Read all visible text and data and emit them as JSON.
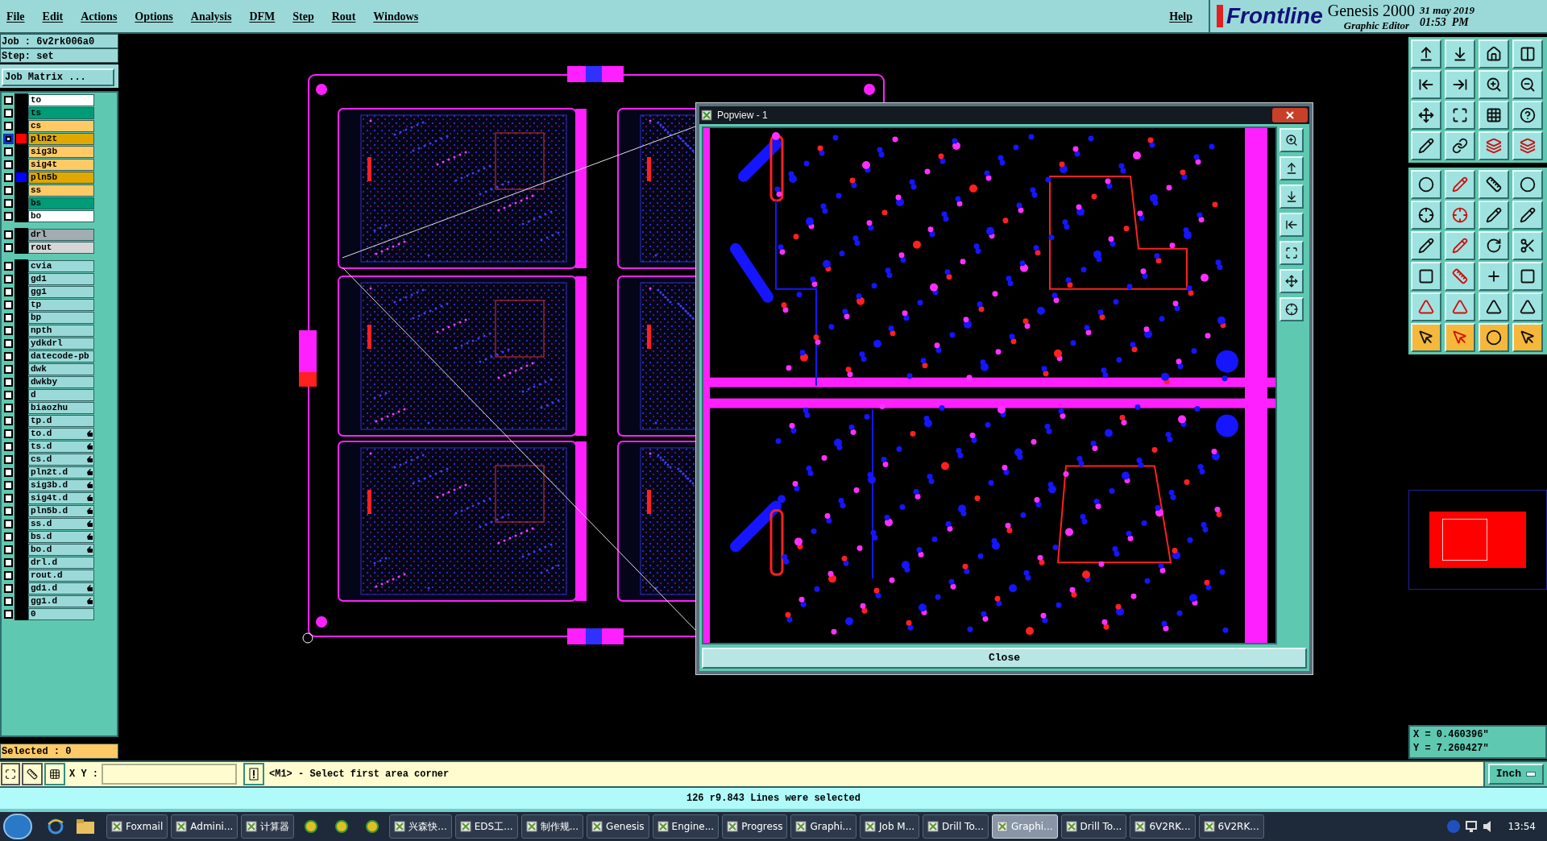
{
  "menu": [
    {
      "label": "File"
    },
    {
      "label": "Edit"
    },
    {
      "label": "Actions"
    },
    {
      "label": "Options"
    },
    {
      "label": "Analysis"
    },
    {
      "label": "DFM"
    },
    {
      "label": "Step"
    },
    {
      "label": "Rout"
    },
    {
      "label": "Windows"
    }
  ],
  "help": "Help",
  "brand": {
    "logo": "Frontline",
    "product": "Genesis 2000",
    "subtitle": "Graphic Editor",
    "date": "31 may 2019",
    "time": "01:53  PM"
  },
  "job": {
    "job": "Job : 6v2rk006a0",
    "step": "Step: set",
    "matrix_button": "Job Matrix ..."
  },
  "layer_groups": [
    [
      {
        "name": "to",
        "color": "#ffffff",
        "selected": false
      },
      {
        "name": "ts",
        "color": "#009b77",
        "selected": false
      },
      {
        "name": "cs",
        "color": "#ffc966",
        "selected": false
      },
      {
        "name": "pln2t",
        "color": "#e0a800",
        "selected": true,
        "swatch": {
          "color": "#ff0000"
        }
      },
      {
        "name": "sig3b",
        "color": "#ffc966",
        "selected": false
      },
      {
        "name": "sig4t",
        "color": "#ffc966",
        "selected": false
      },
      {
        "name": "pln5b",
        "color": "#e0a800",
        "selected": false,
        "swatch": {
          "color": "#0000ff"
        }
      },
      {
        "name": "ss",
        "color": "#ffc966",
        "selected": false
      },
      {
        "name": "bs",
        "color": "#009b77",
        "selected": false
      },
      {
        "name": "bo",
        "color": "#ffffff",
        "selected": false
      }
    ],
    [
      {
        "name": "drl",
        "color": "#a3acb2",
        "selected": false
      },
      {
        "name": "rout",
        "color": "#d6d6d6",
        "selected": false
      }
    ],
    [
      {
        "name": "cvia",
        "selected": false,
        "linked": false
      },
      {
        "name": "gd1",
        "selected": false,
        "linked": false
      },
      {
        "name": "gg1",
        "selected": false,
        "linked": false
      },
      {
        "name": "tp",
        "selected": false,
        "linked": false
      },
      {
        "name": "bp",
        "selected": false,
        "linked": false
      },
      {
        "name": "npth",
        "selected": false,
        "linked": false
      },
      {
        "name": "ydkdrl",
        "selected": false,
        "linked": false
      },
      {
        "name": "datecode-pb",
        "selected": false,
        "linked": false
      },
      {
        "name": "dwk",
        "selected": false,
        "linked": false
      },
      {
        "name": "dwkby",
        "selected": false,
        "linked": false
      },
      {
        "name": "d",
        "selected": false,
        "linked": false
      },
      {
        "name": "biaozhu",
        "selected": false,
        "linked": false
      },
      {
        "name": "tp.d",
        "selected": false,
        "linked": false
      },
      {
        "name": "to.d",
        "selected": false,
        "linked": true
      },
      {
        "name": "ts.d",
        "selected": false,
        "linked": true
      },
      {
        "name": "cs.d",
        "selected": false,
        "linked": true
      },
      {
        "name": "pln2t.d",
        "selected": false,
        "linked": true
      },
      {
        "name": "sig3b.d",
        "selected": false,
        "linked": true
      },
      {
        "name": "sig4t.d",
        "selected": false,
        "linked": true
      },
      {
        "name": "pln5b.d",
        "selected": false,
        "linked": true
      },
      {
        "name": "ss.d",
        "selected": false,
        "linked": true
      },
      {
        "name": "bs.d",
        "selected": false,
        "linked": true
      },
      {
        "name": "bo.d",
        "selected": false,
        "linked": true
      },
      {
        "name": "drl.d",
        "selected": false,
        "linked": false
      },
      {
        "name": "rout.d",
        "selected": false,
        "linked": false
      },
      {
        "name": "gd1.d",
        "selected": false,
        "linked": true
      },
      {
        "name": "gg1.d",
        "selected": false,
        "linked": true
      },
      {
        "name": "0",
        "selected": false,
        "linked": false
      }
    ]
  ],
  "selected_count": "Selected : 0",
  "popview": {
    "title": "Popview - 1",
    "close_button": "Close"
  },
  "coordinates": {
    "x": "X = 0.460396\"",
    "y": "Y = 7.260427\""
  },
  "command": {
    "xy_label": "X Y :",
    "prompt": "<M1> - Select first area corner",
    "units": "Inch"
  },
  "status": "126 r9.843 Lines were selected",
  "taskbar": {
    "items": [
      {
        "kind": "app",
        "label": "Foxmail",
        "selected": false
      },
      {
        "kind": "app",
        "label": "Admini...",
        "selected": false
      },
      {
        "kind": "app",
        "label": "计算器",
        "selected": false
      },
      {
        "kind": "icon",
        "selected": false
      },
      {
        "kind": "icon",
        "selected": false
      },
      {
        "kind": "icon",
        "selected": false
      },
      {
        "kind": "app",
        "label": "兴森快...",
        "selected": false
      },
      {
        "kind": "app",
        "label": "EDS工...",
        "selected": false
      },
      {
        "kind": "app",
        "label": "制作规...",
        "selected": false
      },
      {
        "kind": "app",
        "label": "Genesis",
        "selected": false
      },
      {
        "kind": "app",
        "label": "Engine...",
        "selected": false
      },
      {
        "kind": "app",
        "label": "Progress",
        "selected": false
      },
      {
        "kind": "app",
        "label": "Graphi...",
        "selected": false
      },
      {
        "kind": "app",
        "label": "Job M...",
        "selected": false
      },
      {
        "kind": "app",
        "label": "Drill To...",
        "selected": false
      },
      {
        "kind": "app",
        "label": "Graphi...",
        "selected": true
      },
      {
        "kind": "app",
        "label": "Drill To...",
        "selected": false
      },
      {
        "kind": "app",
        "label": "6V2RK...",
        "selected": false
      },
      {
        "kind": "app",
        "label": "6V2RK...",
        "selected": false
      }
    ],
    "clock": "13:54"
  }
}
